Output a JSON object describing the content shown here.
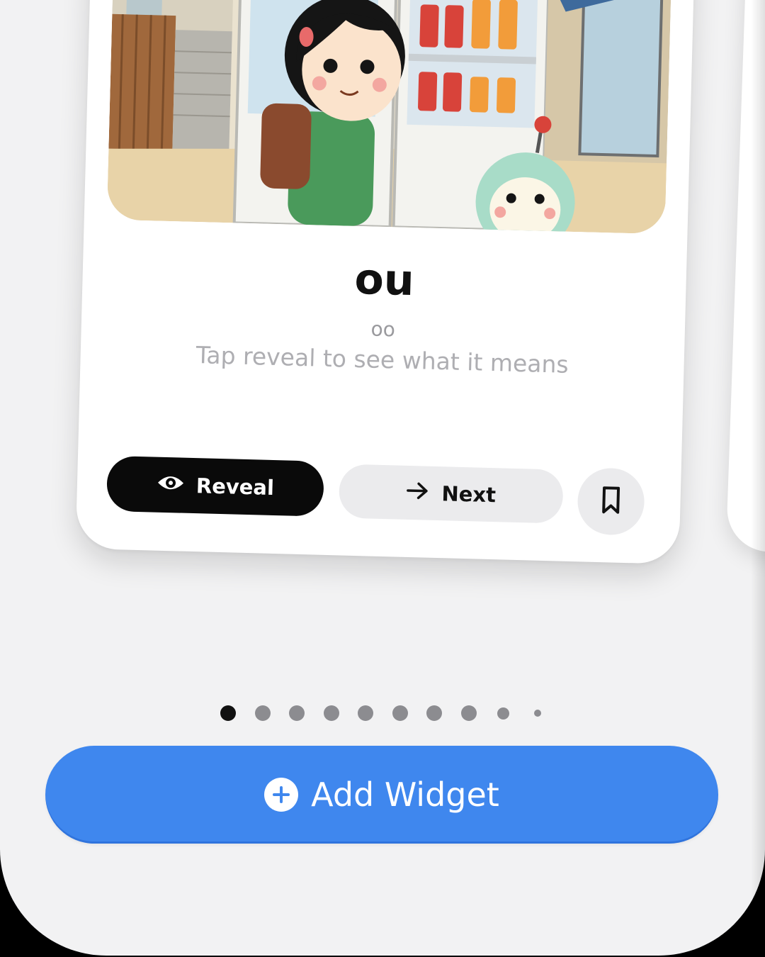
{
  "card": {
    "word": "ou",
    "romaji": "oo",
    "hint": "Tap reveal to see what it means",
    "illustration": "girl-with-backpack-at-vending-machine-with-robot-mascot"
  },
  "actions": {
    "reveal_label": "Reveal",
    "reveal_icon": "eye-icon",
    "next_label": "Next",
    "next_icon": "arrow-right-icon",
    "bookmark_icon": "bookmark-icon"
  },
  "pager": {
    "total_dots": 10,
    "active_index": 0
  },
  "add_widget": {
    "label": "Add Widget",
    "icon": "plus-circle-icon"
  },
  "colors": {
    "accent": "#3f87ee",
    "reveal_bg": "#0a0a0a",
    "secondary_bg": "#ebebed",
    "background": "#f2f2f3"
  }
}
